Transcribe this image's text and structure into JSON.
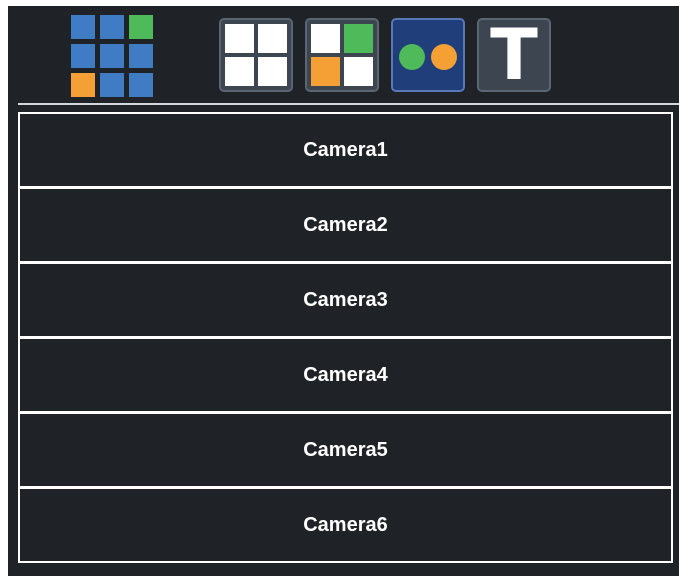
{
  "toolbar": {
    "app_logo_icon": "grid-3x3-icon",
    "buttons": [
      {
        "name": "layout-2x2-button",
        "icon": "grid-2x2-icon",
        "selected": false
      },
      {
        "name": "layout-mixed-button",
        "icon": "grid-2x2-colored-icon",
        "selected": false
      },
      {
        "name": "layout-dots-button",
        "icon": "two-dots-icon",
        "selected": true
      },
      {
        "name": "text-mode-button",
        "icon": "letter-t-icon",
        "selected": false,
        "label": "T"
      }
    ]
  },
  "colors": {
    "background": "#1f2226",
    "logo_blue": "#3f7cc4",
    "logo_green": "#4fba5a",
    "logo_orange": "#f5a034",
    "selected_button": "#1f3e7a",
    "button": "#3c4550",
    "item_border": "#ffffff",
    "item_text": "#ffffff"
  },
  "cameras": [
    {
      "label": "Camera1"
    },
    {
      "label": "Camera2"
    },
    {
      "label": "Camera3"
    },
    {
      "label": "Camera4"
    },
    {
      "label": "Camera5"
    },
    {
      "label": "Camera6"
    }
  ]
}
